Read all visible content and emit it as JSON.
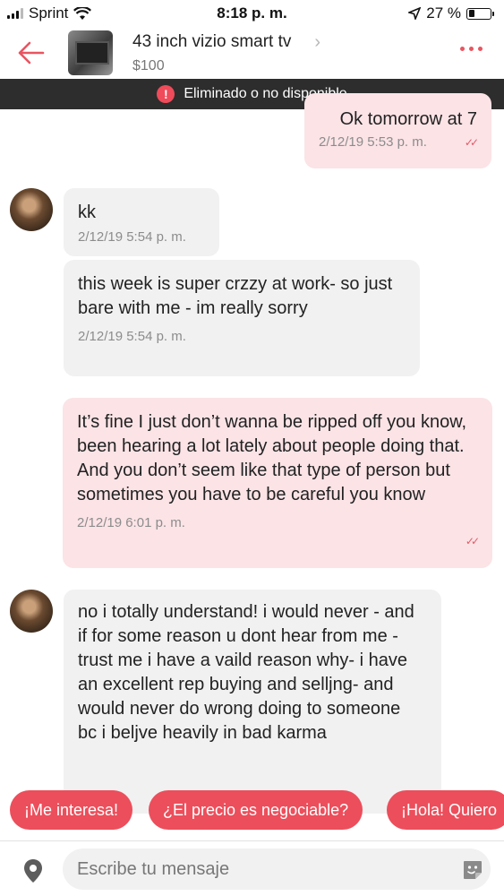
{
  "status_bar": {
    "carrier": "Sprint",
    "time": "8:18 p. m.",
    "battery": "27 %",
    "battery_level": 0.27
  },
  "header": {
    "title": "43 inch vizio smart tv",
    "price": "$100"
  },
  "banner": {
    "icon": "!",
    "text": "Eliminado o no disponible"
  },
  "messages": [
    {
      "direction": "out",
      "text": "Ok tomorrow at 7",
      "time": "2/12/19 5:53 p. m."
    },
    {
      "direction": "in",
      "text": "kk",
      "time": "2/12/19 5:54 p. m."
    },
    {
      "direction": "in",
      "text": "this week is super crzzy at work- so just bare with me - im really sorry",
      "time": "2/12/19 5:54 p. m."
    },
    {
      "direction": "out",
      "text": "It’s fine I just don’t wanna be ripped off you know, been hearing a lot lately about people doing that. And you don’t seem like that type of person but sometimes you have to be careful you know",
      "time": "2/12/19 6:01 p. m."
    },
    {
      "direction": "in",
      "text": "no i totally understand!  i would never - and if for some reason u dont hear from me - trust me i have a vaild reason why- i have an excellent rep buying and selljng- and would never do wrong doing to someone bc i beljve heavily in bad karma",
      "time": ""
    }
  ],
  "quick_replies": [
    "¡Me interesa!",
    "¿El precio es negociable?",
    "¡Hola! Quiero"
  ],
  "composer": {
    "placeholder": "Escribe tu mensaje"
  },
  "colors": {
    "accent": "#ec4e5b",
    "outgoing_bubble": "#fbe3e6",
    "incoming_bubble": "#f1f1f1",
    "banner": "#2d2d2d"
  },
  "icons": [
    "back-arrow-icon",
    "chevron-right-icon",
    "more-dots-icon",
    "alert-icon",
    "double-check-icon",
    "location-pin-icon",
    "sticker-icon"
  ]
}
